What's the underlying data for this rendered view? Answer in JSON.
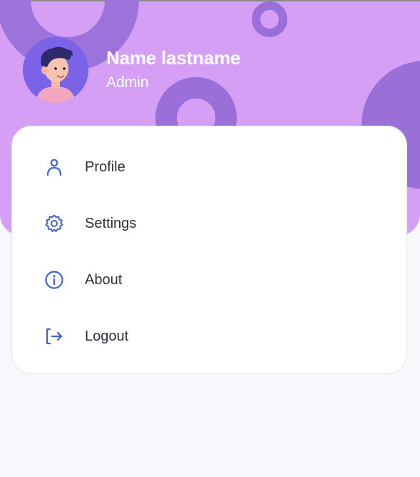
{
  "user": {
    "name": "Name lastname",
    "role": "Admin",
    "avatar_icon": "person-avatar-icon"
  },
  "menu": {
    "items": [
      {
        "label": "Profile",
        "icon": "user-icon"
      },
      {
        "label": "Settings",
        "icon": "gear-icon"
      },
      {
        "label": "About",
        "icon": "info-icon"
      },
      {
        "label": "Logout",
        "icon": "logout-icon"
      }
    ]
  },
  "colors": {
    "header_bg": "#d59ff5",
    "decor": "#9a6fd8",
    "icon_blue": "#3d63d6",
    "page_bg": "#f7f8fc",
    "text_dark": "#2b2f3a"
  }
}
